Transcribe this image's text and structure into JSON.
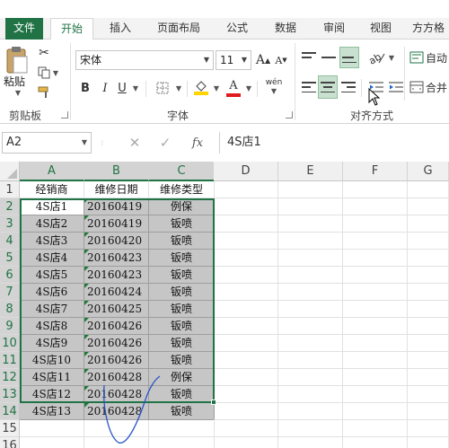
{
  "tabs": [
    "文件",
    "开始",
    "插入",
    "页面布局",
    "公式",
    "数据",
    "审阅",
    "视图",
    "方方格"
  ],
  "ribbon": {
    "clipboard": {
      "paste": "粘贴",
      "label": "剪贴板"
    },
    "font": {
      "name": "宋体",
      "size": "11",
      "bold": "B",
      "italic": "I",
      "underline": "U",
      "font_color_letter": "A",
      "grow": "A",
      "shrink": "A",
      "phonetic": "wén",
      "label": "字体"
    },
    "alignment": {
      "wrap_partial": "自动",
      "merge_partial": "合并",
      "label": "对齐方式"
    },
    "colors": {
      "accent": "#217346",
      "font_color_bar": "#e01b1b",
      "fill_bar": "#ffd400"
    }
  },
  "formula_bar": {
    "cell_ref": "A2",
    "value": "4S店1",
    "fx": "fx"
  },
  "sheet": {
    "columns": [
      "A",
      "B",
      "C",
      "D",
      "E",
      "F",
      "G"
    ],
    "rows": [
      "1",
      "2",
      "3",
      "4",
      "5",
      "6",
      "7",
      "8",
      "9",
      "10",
      "11",
      "12",
      "13",
      "14",
      "15",
      "16"
    ],
    "header": [
      "经销商",
      "维修日期",
      "维修类型"
    ],
    "records": [
      [
        "4S店1",
        "20160419",
        "例保"
      ],
      [
        "4S店2",
        "20160419",
        "钣喷"
      ],
      [
        "4S店3",
        "20160420",
        "钣喷"
      ],
      [
        "4S店4",
        "20160423",
        "钣喷"
      ],
      [
        "4S店5",
        "20160423",
        "钣喷"
      ],
      [
        "4S店6",
        "20160424",
        "钣喷"
      ],
      [
        "4S店7",
        "20160425",
        "钣喷"
      ],
      [
        "4S店8",
        "20160426",
        "钣喷"
      ],
      [
        "4S店9",
        "20160426",
        "钣喷"
      ],
      [
        "4S店10",
        "20160426",
        "钣喷"
      ],
      [
        "4S店11",
        "20160428",
        "例保"
      ],
      [
        "4S店12",
        "20160428",
        "钣喷"
      ],
      [
        "4S店13",
        "20160428",
        "钣喷"
      ]
    ]
  }
}
